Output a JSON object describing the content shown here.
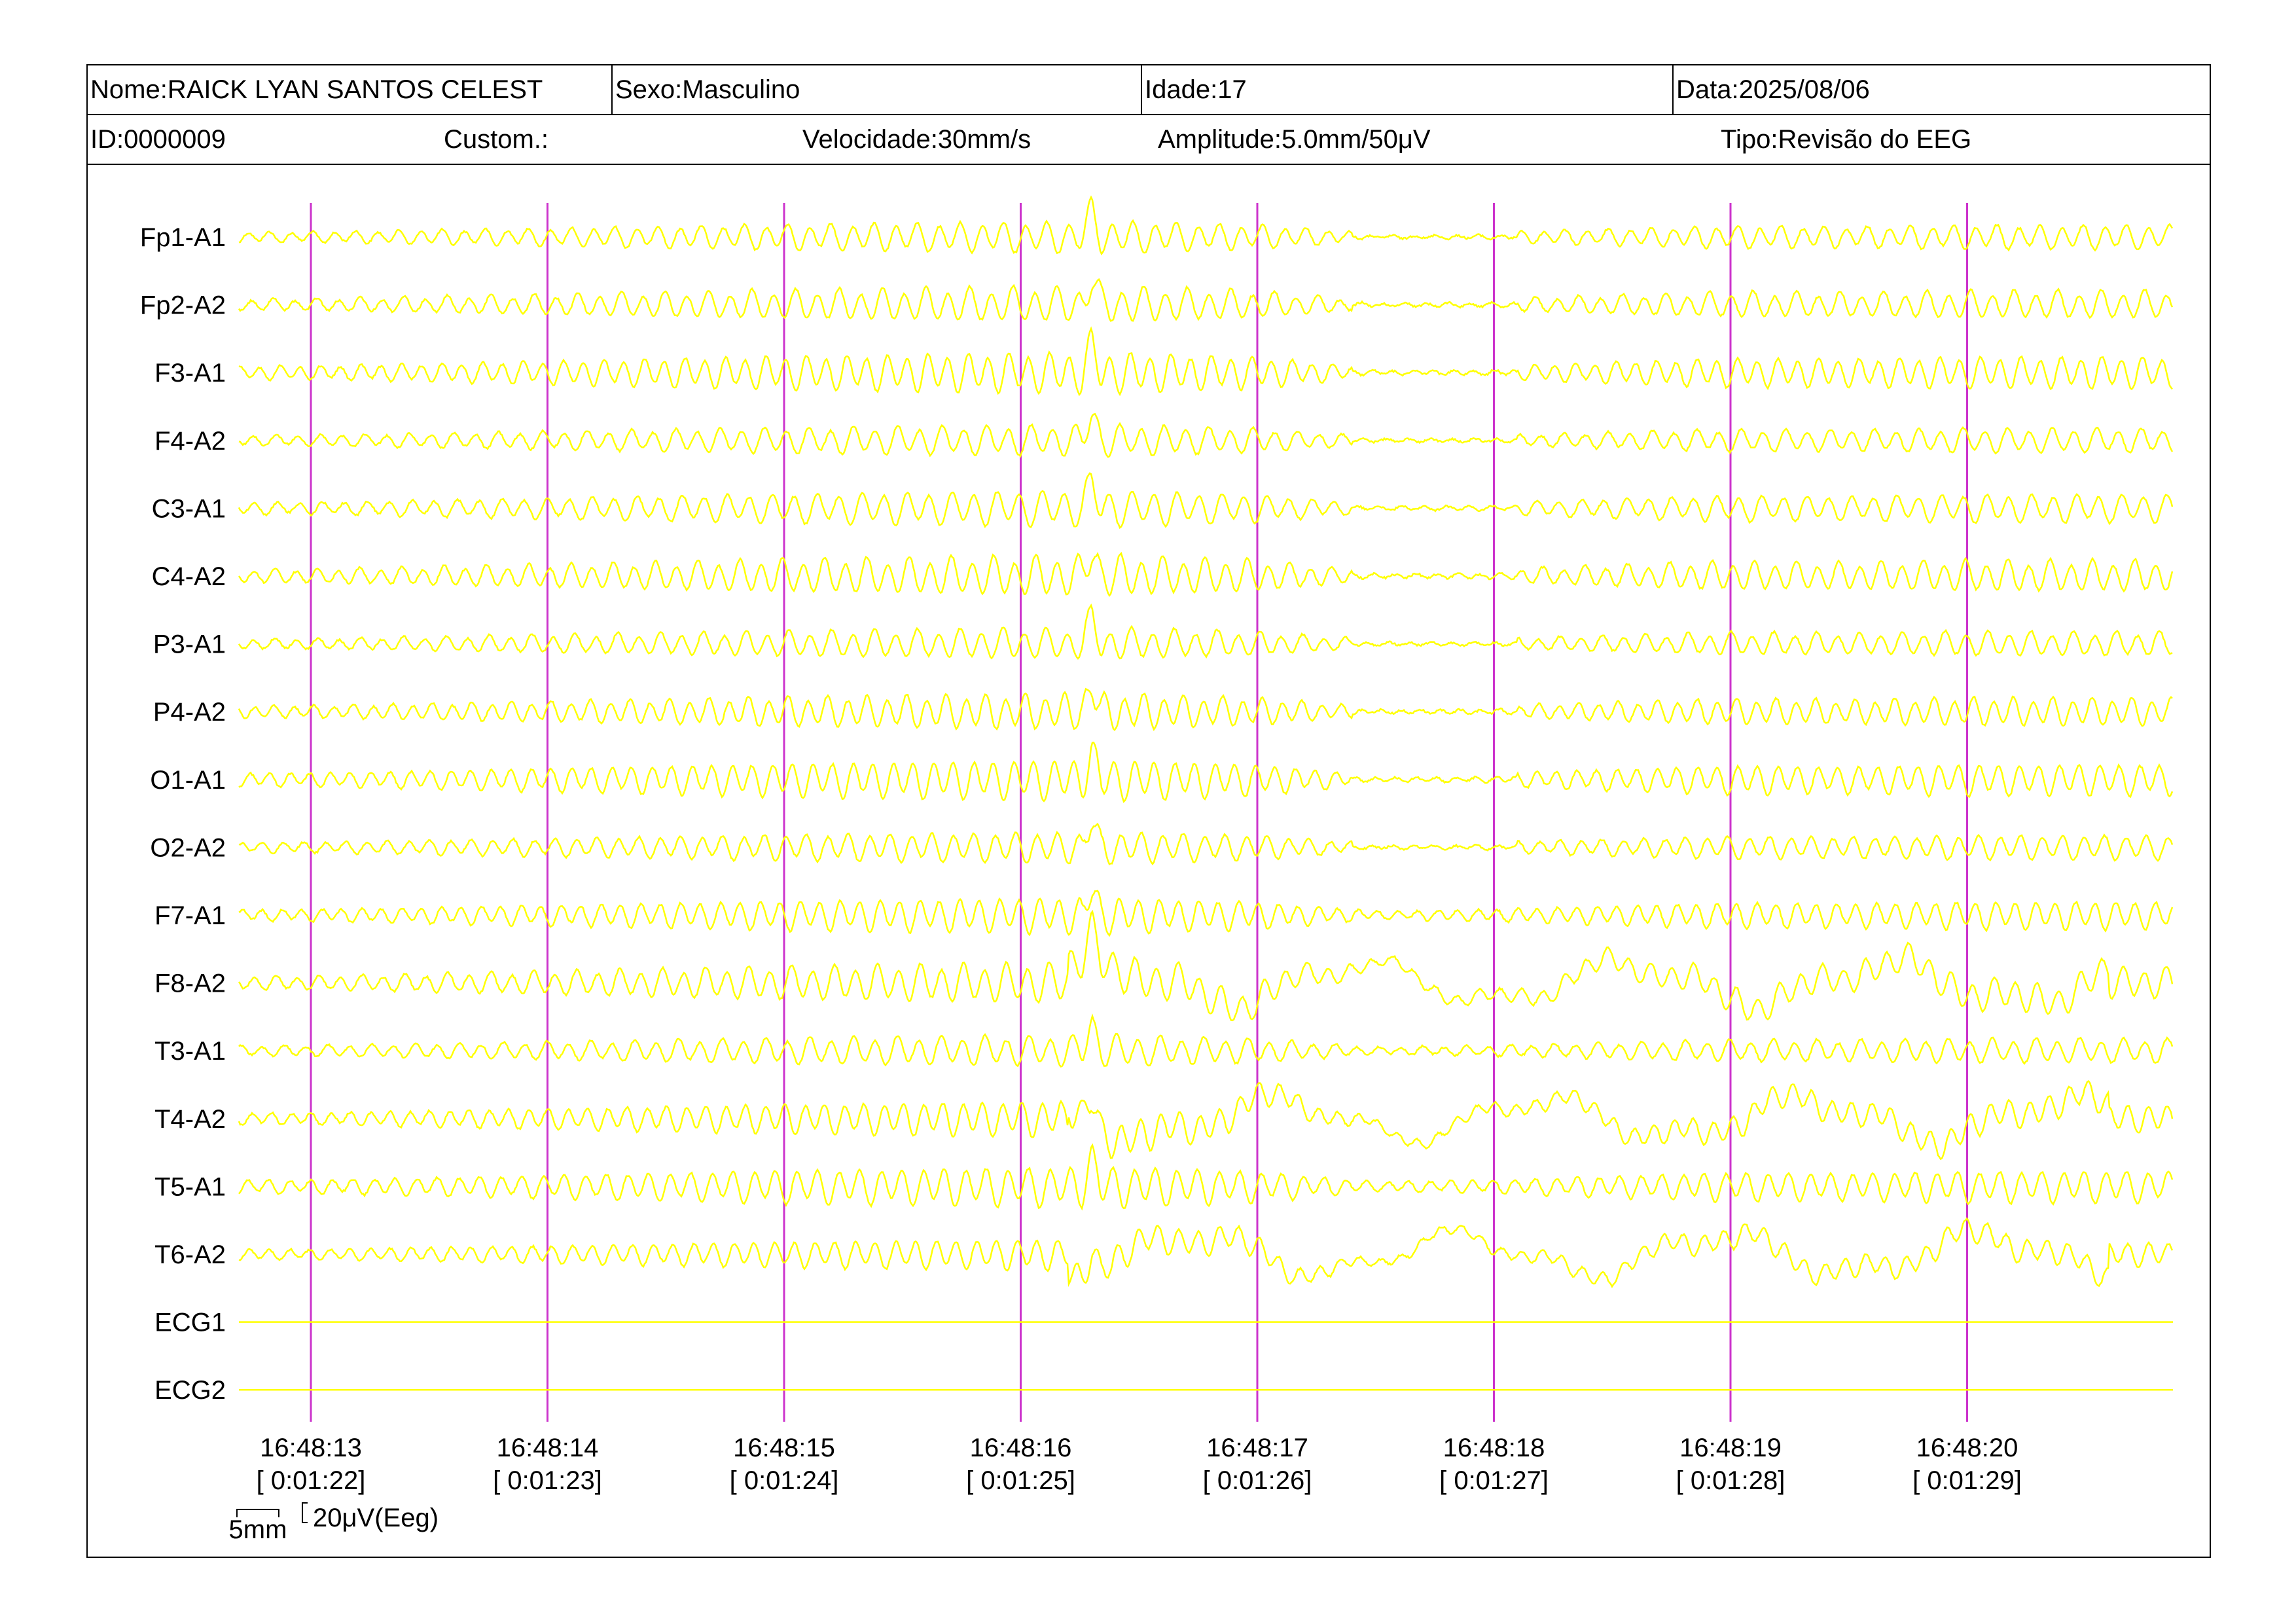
{
  "header": {
    "name": "Nome:RAICK LYAN SANTOS CELEST",
    "sex": "Sexo:Masculino",
    "age": "Idade:17",
    "date": "Data:2025/08/06",
    "id": "ID:0000009",
    "custom": "Custom.:",
    "speed": "Velocidade:30mm/s",
    "amplitude": "Amplitude:5.0mm/50μV",
    "type": "Tipo:Revisão do EEG"
  },
  "colors": {
    "trace": "#ffff00",
    "marker": "#cc33cc",
    "text": "#000000",
    "background": "#ffffff"
  },
  "chart_data": {
    "type": "line",
    "title": "",
    "xlabel": "",
    "ylabel": "",
    "channels": [
      "Fp1-A1",
      "Fp2-A2",
      "F3-A1",
      "F4-A2",
      "C3-A1",
      "C4-A2",
      "P3-A1",
      "P4-A2",
      "O1-A1",
      "O2-A2",
      "F7-A1",
      "F8-A2",
      "T3-A1",
      "T4-A2",
      "T5-A1",
      "T6-A2",
      "ECG1",
      "ECG2"
    ],
    "time_ticks": [
      {
        "time": "16:48:13",
        "elapsed": "[ 0:01:22]"
      },
      {
        "time": "16:48:14",
        "elapsed": "[ 0:01:23]"
      },
      {
        "time": "16:48:15",
        "elapsed": "[ 0:01:24]"
      },
      {
        "time": "16:48:16",
        "elapsed": "[ 0:01:25]"
      },
      {
        "time": "16:48:17",
        "elapsed": "[ 0:01:26]"
      },
      {
        "time": "16:48:18",
        "elapsed": "[ 0:01:27]"
      },
      {
        "time": "16:48:19",
        "elapsed": "[ 0:01:28]"
      },
      {
        "time": "16:48:20",
        "elapsed": "[ 0:01:29]"
      }
    ],
    "xlim_seconds": [
      -0.3,
      7.85
    ],
    "amplitude_profile_seconds": [
      [
        0.0,
        0.35
      ],
      [
        1.0,
        0.6
      ],
      [
        2.0,
        0.85
      ],
      [
        3.0,
        1.0
      ],
      [
        3.4,
        1.05
      ],
      [
        4.0,
        0.8
      ],
      [
        4.5,
        0.25
      ],
      [
        5.0,
        0.35
      ],
      [
        5.5,
        0.55
      ],
      [
        6.0,
        0.75
      ],
      [
        6.5,
        0.7
      ],
      [
        7.0,
        0.8
      ],
      [
        7.85,
        0.8
      ]
    ],
    "events_seconds": {
      "spike": 3.3,
      "flat_segment": [
        4.4,
        5.1
      ],
      "temporal_slowing": [
        3.2,
        7.6
      ]
    },
    "scale_bar": {
      "time_label": "5mm",
      "amplitude_label": "20μV(Eeg)"
    },
    "grid": false
  }
}
